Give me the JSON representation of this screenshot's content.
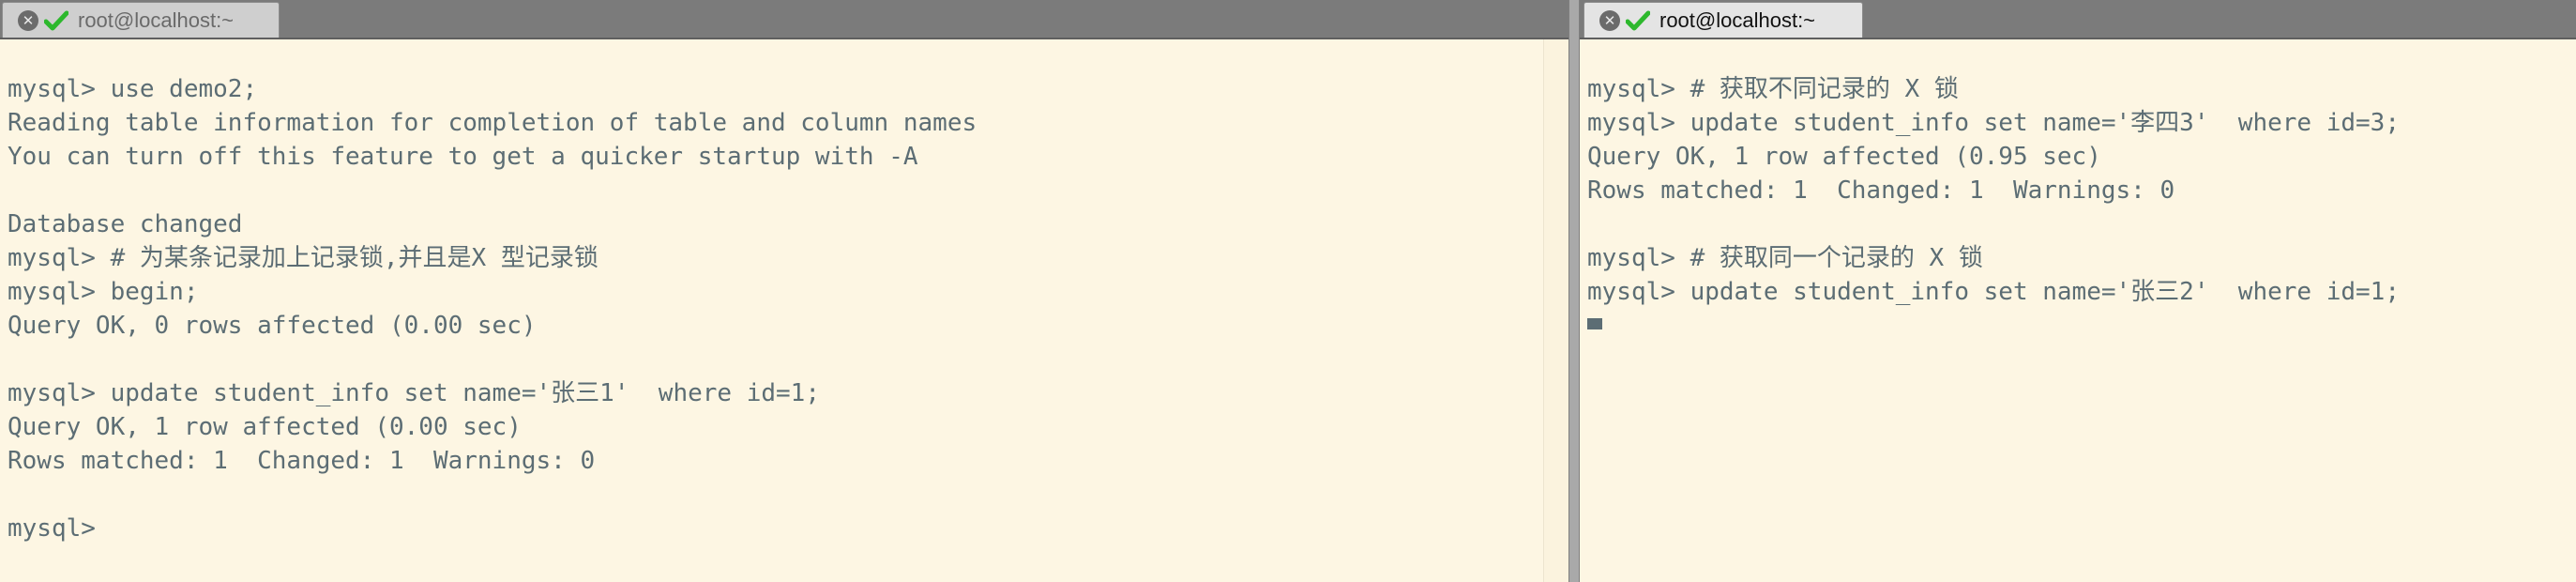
{
  "left": {
    "tab_title": "root@localhost:~",
    "lines": [
      "mysql> use demo2;",
      "Reading table information for completion of table and column names",
      "You can turn off this feature to get a quicker startup with -A",
      "",
      "Database changed",
      "mysql> # 为某条记录加上记录锁,并且是X 型记录锁",
      "mysql> begin;",
      "Query OK, 0 rows affected (0.00 sec)",
      "",
      "mysql> update student_info set name='张三1'  where id=1;",
      "Query OK, 1 row affected (0.00 sec)",
      "Rows matched: 1  Changed: 1  Warnings: 0",
      "",
      "mysql> "
    ]
  },
  "right": {
    "tab_title": "root@localhost:~",
    "lines": [
      "mysql> # 获取不同记录的 X 锁",
      "mysql> update student_info set name='李四3'  where id=3;",
      "Query OK, 1 row affected (0.95 sec)",
      "Rows matched: 1  Changed: 1  Warnings: 0",
      "",
      "mysql> # 获取同一个记录的 X 锁",
      "mysql> update student_info set name='张三2'  where id=1;",
      ""
    ]
  },
  "colors": {
    "terminal_bg": "#fdf6e3",
    "terminal_fg": "#5c6d74",
    "check": "#2db82d"
  },
  "icons": {
    "close": "close-icon",
    "status": "check-icon"
  }
}
